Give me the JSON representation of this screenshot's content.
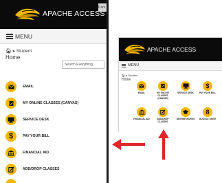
{
  "colors": {
    "header_bg": "#0b0b0b",
    "icon_gold": "#f2b705",
    "arrow_red": "#e0262b",
    "menubar_bg": "#f4f4f4"
  },
  "mobile": {
    "brand": "APACHE ACCESS",
    "peek_tab": "Pam",
    "menu_label": "MENU",
    "breadcrumb_section": "Student",
    "breadcrumb_page": "Home",
    "search_placeholder": "Search Everything",
    "items": [
      {
        "icon": "envelope-icon",
        "label": "EMAIL"
      },
      {
        "icon": "pencil-book-icon",
        "label": "MY ONLINE CLASSES (CANVAS)"
      },
      {
        "icon": "monitor-icon",
        "label": "SERVICE DESK"
      },
      {
        "icon": "dollar-icon",
        "label": "PAY YOUR BILL"
      },
      {
        "icon": "bank-icon",
        "label": "FINANCIAL AID"
      },
      {
        "icon": "edit-icon",
        "label": "ADD/DROP CLASSES"
      }
    ]
  },
  "desktop": {
    "brand": "APACHE ACCESS",
    "menu_label": "MENU",
    "breadcrumb_section": "Student",
    "breadcrumb_page": "Home",
    "items": [
      {
        "icon": "envelope-icon",
        "label": "EMAIL"
      },
      {
        "icon": "pencil-book-icon",
        "label": "MY ONLINE\nCLASSES\n(CANVAS)"
      },
      {
        "icon": "monitor-icon",
        "label": "SERVICE DESK"
      },
      {
        "icon": "dollar-icon",
        "label": "PAY YOUR BILL"
      },
      {
        "icon": "bank-icon",
        "label": "FINANCIAL AID"
      },
      {
        "icon": "edit-icon",
        "label": "ADD/DROP\nCLASSES"
      },
      {
        "icon": "graduation-cap-icon",
        "label": "DEGREE WORKS"
      },
      {
        "icon": "google-icon",
        "label": "GOOGLE DRIVE"
      }
    ]
  }
}
